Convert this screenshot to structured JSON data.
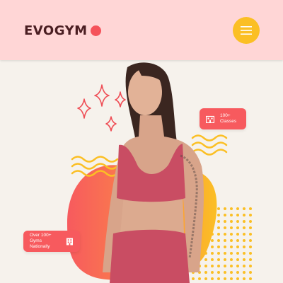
{
  "header": {
    "logo_text": "EVOGYM",
    "accent": "#f5525a",
    "menu_icon": "hamburger-icon",
    "menu_color": "#fbbf24"
  },
  "hero": {
    "chip_classes": {
      "icon": "building-icon",
      "text": "100+\nClasses"
    },
    "chip_gyms": {
      "icon": "buildings-icon",
      "text": "Over 100+\nGyms Nationally"
    }
  },
  "colors": {
    "header_bg": "#ffd6d6",
    "page_bg": "#f6f2ec",
    "chip_bg": "#f75a5e",
    "gradient_start": "#f75a5e",
    "gradient_end": "#fbbf24"
  }
}
